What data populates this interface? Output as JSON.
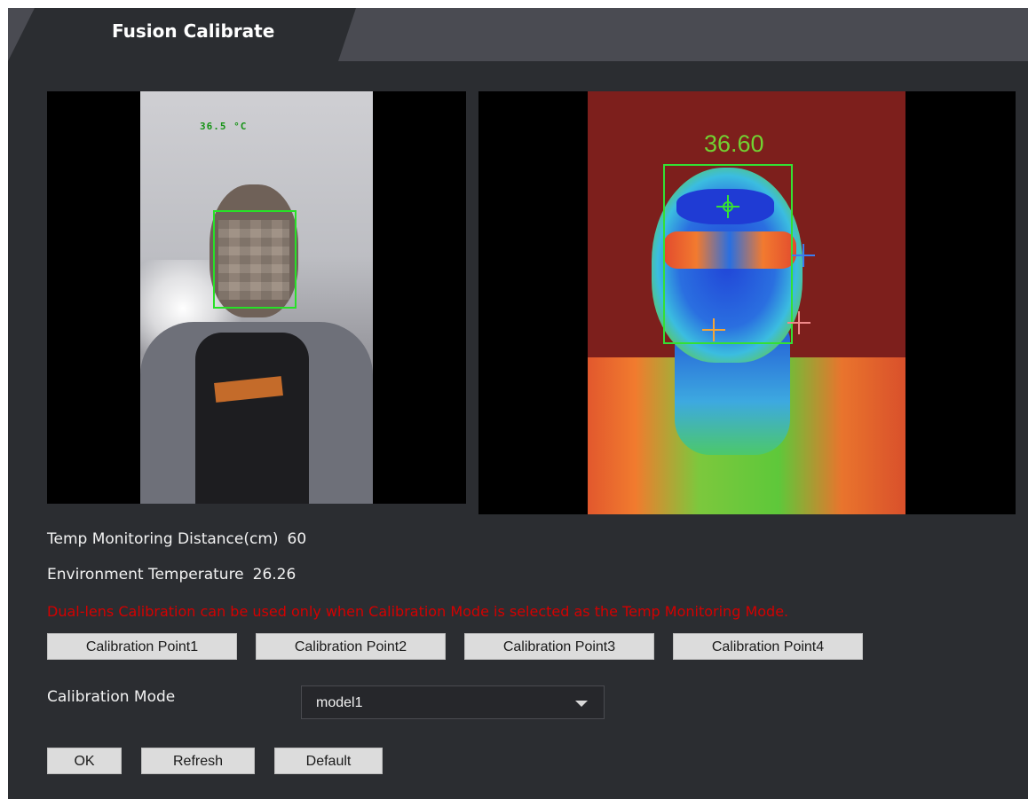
{
  "tab": {
    "title": "Fusion Calibrate"
  },
  "camera_views": {
    "visible_temp": "36.5 °C",
    "thermal_temp": "36.60"
  },
  "info": {
    "distance_label": "Temp Monitoring Distance(cm)",
    "distance_value": "60",
    "env_label": "Environment Temperature",
    "env_value": "26.26",
    "warning": "Dual-lens Calibration can be used only when Calibration Mode is selected as the Temp Monitoring Mode."
  },
  "calibration_points": [
    {
      "label": "Calibration Point1"
    },
    {
      "label": "Calibration Point2"
    },
    {
      "label": "Calibration Point3"
    },
    {
      "label": "Calibration Point4"
    }
  ],
  "calibration_mode": {
    "label": "Calibration Mode",
    "selected": "model1"
  },
  "actions": {
    "ok": "OK",
    "refresh": "Refresh",
    "default": "Default"
  },
  "colors": {
    "panel_bg": "#2b2d31",
    "warning_text": "#d40000",
    "detection_box": "#28e028"
  },
  "icons": [
    "crosshair-icon",
    "dropdown-arrow-icon"
  ]
}
